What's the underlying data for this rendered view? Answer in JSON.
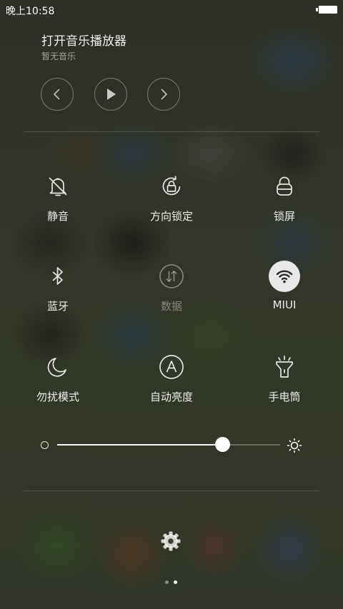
{
  "status_bar": {
    "time": "晚上10:58",
    "battery_icon": "battery-full-icon"
  },
  "music": {
    "title": "打开音乐播放器",
    "subtitle": "暂无音乐",
    "controls": {
      "prev_icon": "previous-icon",
      "play_icon": "play-icon",
      "next_icon": "next-icon"
    }
  },
  "toggles": [
    {
      "label": "静音",
      "icon": "bell-muted-icon",
      "state": "off"
    },
    {
      "label": "方向锁定",
      "icon": "rotation-lock-icon",
      "state": "off"
    },
    {
      "label": "锁屏",
      "icon": "lock-icon",
      "state": "off"
    },
    {
      "label": "蓝牙",
      "icon": "bluetooth-icon",
      "state": "off"
    },
    {
      "label": "数据",
      "icon": "mobile-data-icon",
      "state": "disabled"
    },
    {
      "label": "MIUI",
      "icon": "wifi-icon",
      "state": "on"
    },
    {
      "label": "勿扰模式",
      "icon": "moon-icon",
      "state": "off"
    },
    {
      "label": "自动亮度",
      "icon": "auto-brightness-icon",
      "state": "off"
    },
    {
      "label": "手电筒",
      "icon": "flashlight-icon",
      "state": "off"
    }
  ],
  "brightness": {
    "level_percent": 74,
    "min_icon": "brightness-low-icon",
    "max_icon": "brightness-high-icon"
  },
  "settings_icon": "gear-icon",
  "pager": {
    "count": 2,
    "current": 2
  },
  "colors": {
    "active_toggle_bg": "#e8e8e8",
    "dot_active": "#ffffff",
    "dot_inactive": "#8a8d80"
  }
}
